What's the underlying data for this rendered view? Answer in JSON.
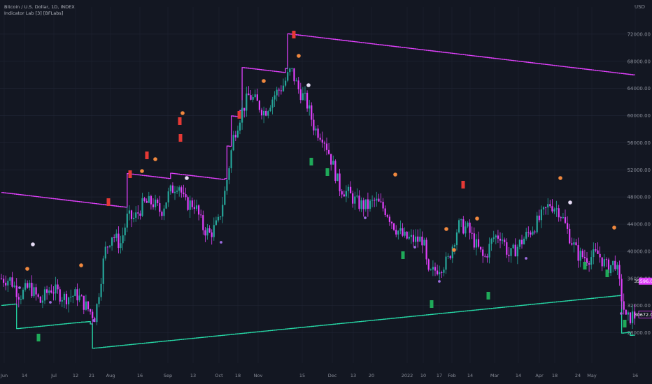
{
  "legend": {
    "symbol_line": "Bitcoin / U.S. Dollar, 1D, INDEX",
    "indicator_line": "Indicator Lab [3] [BFLabs]"
  },
  "axis": {
    "currency": "USD"
  },
  "colors": {
    "background": "#131722",
    "upper_band": "#e040fb",
    "lower_band": "#26d9a6",
    "candle_up": "#26a69a",
    "candle_down": "#e040fb",
    "sell_marker": "#e53935",
    "buy_marker": "#1faa59",
    "orange_dot": "#f0883e",
    "light_dot": "#e6dcf5",
    "purple_drop": "#9c6ce0",
    "grid": "#1f2433"
  },
  "chart_data": {
    "type": "candlestick",
    "y_axis": {
      "ticks": [
        "72000.00",
        "68000.00",
        "64000.00",
        "60000.00",
        "56000.00",
        "52000.00",
        "48000.00",
        "44000.00",
        "40000.00",
        "36000.00",
        "32000.00",
        "28000.00"
      ],
      "range": [
        26000,
        76000
      ]
    },
    "x_axis": {
      "ticks": [
        "Jun",
        "14",
        "Jul",
        "12",
        "21",
        "Aug",
        "16",
        "Sep",
        "13",
        "Oct",
        "18",
        "Nov",
        "15",
        "Dec",
        "13",
        "20",
        "2022",
        "10",
        "17",
        "Feb",
        "14",
        "Mar",
        "14",
        "Apr",
        "18",
        "24",
        "May",
        "16"
      ]
    },
    "price_label": "35596.00",
    "price_label_2": "30672.00",
    "series": [
      {
        "name": "upper",
        "role": "trailing upper band"
      },
      {
        "name": "lower",
        "role": "trailing lower band"
      }
    ]
  }
}
